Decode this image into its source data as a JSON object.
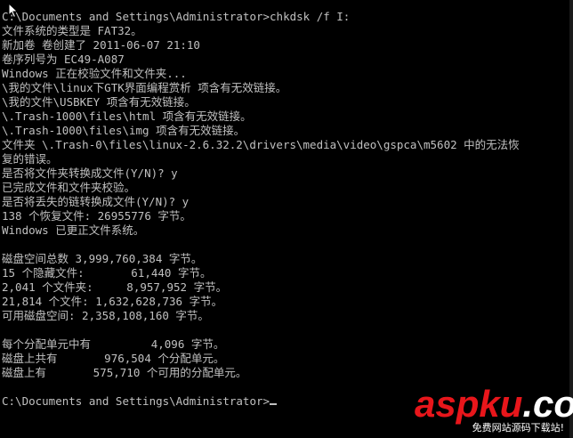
{
  "console": {
    "lines": [
      "C:\\Documents and Settings\\Administrator>chkdsk /f I:",
      "文件系统的类型是 FAT32。",
      "新加卷 卷创建了 2011-06-07 21:10",
      "卷序列号为 EC49-A087",
      "Windows 正在校验文件和文件夹...",
      "\\我的文件\\linux下GTK界面编程赏析 项含有无效链接。",
      "\\我的文件\\USBKEY 项含有无效链接。",
      "\\.Trash-1000\\files\\html 项含有无效链接。",
      "\\.Trash-1000\\files\\img 项含有无效链接。",
      "文件夹 \\.Trash-0\\files\\linux-2.6.32.2\\drivers\\media\\video\\gspca\\m5602 中的无法恢",
      "复的错误。",
      "是否将文件夹转换成文件(Y/N)? y",
      "已完成文件和文件夹校验。",
      "是否将丢失的链转换成文件(Y/N)? y",
      "138 个恢复文件: 26955776 字节。",
      "Windows 已更正文件系统。",
      "",
      "磁盘空间总数 3,999,760,384 字节。",
      "15 个隐藏文件:       61,440 字节。",
      "2,041 个文件夹:     8,957,952 字节。",
      "21,814 个文件: 1,632,628,736 字节。",
      "可用磁盘空间: 2,358,108,160 字节。",
      "",
      "每个分配单元中有         4,096 字节。",
      "磁盘上共有       976,504 个分配单元。",
      "磁盘上有       575,710 个可用的分配单元。",
      "",
      "C:\\Documents and Settings\\Administrator>"
    ]
  },
  "watermark": {
    "brand_part1": "asp",
    "brand_part2": "ku",
    "brand_part3": ".com",
    "tagline": "免费网站源码下载站!"
  },
  "colors": {
    "background": "#000000",
    "text": "#c0c0c0",
    "brand_red": "#e8161b",
    "brand_white": "#ffffff"
  },
  "icons": {
    "pointer": "mouse-pointer-icon"
  }
}
